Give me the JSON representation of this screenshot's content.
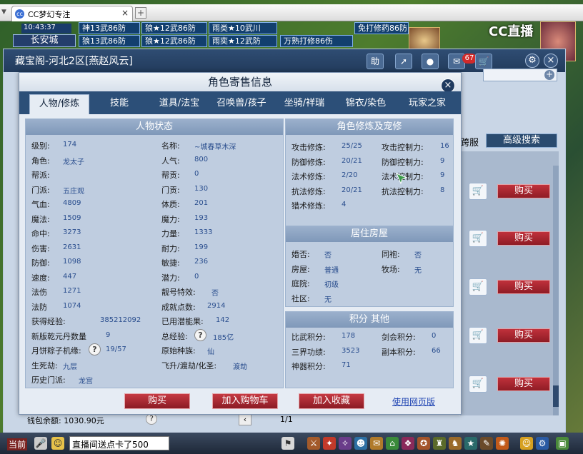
{
  "browser": {
    "tab_title": "CC梦幻专注",
    "new_tab": "+",
    "close": "×"
  },
  "hud": {
    "clock": "10:43:37",
    "location": "长安城",
    "chips": [
      "神13武86防",
      "狼★12武86防",
      "雨类★10武川",
      "狼13武86防",
      "狼★12武86防",
      "雨奕★12武防",
      "万熟打修86伤",
      "免打修药86防"
    ],
    "cc_logo": "CC直播"
  },
  "bg_window": {
    "title": "藏宝阁-河北2区[燕赵风云]",
    "help_label": "助",
    "badge": "67",
    "cross_server": "跨服",
    "advanced_search": "高级搜索",
    "buy_label": "购买",
    "money": "钱包余额: 1030.90元",
    "page": "1/1"
  },
  "modal": {
    "title": "角色寄售信息",
    "tabs": [
      "人物/修炼",
      "技能",
      "道具/法宝",
      "召唤兽/孩子",
      "坐骑/祥瑞",
      "锦衣/染色",
      "玩家之家"
    ],
    "status": {
      "header": "人物状态",
      "left": [
        {
          "label": "级别:",
          "value": "174"
        },
        {
          "label": "角色:",
          "value": "龙太子"
        },
        {
          "label": "帮派:",
          "value": ""
        },
        {
          "label": "门派:",
          "value": "五庄观"
        },
        {
          "label": "气血:",
          "value": "4809"
        },
        {
          "label": "魔法:",
          "value": "1509"
        },
        {
          "label": "命中:",
          "value": "3273"
        },
        {
          "label": "伤害:",
          "value": "2631"
        },
        {
          "label": "防御:",
          "value": "1098"
        },
        {
          "label": "速度:",
          "value": "447"
        },
        {
          "label": "法伤",
          "value": "1271"
        },
        {
          "label": "法防",
          "value": "1074"
        },
        {
          "label": "获得经验:",
          "value": "385212092"
        },
        {
          "label": "新版乾元丹数量",
          "value": "9"
        },
        {
          "label": "月饼粽子机缘:",
          "value": "19/57"
        },
        {
          "label": "生死劫:",
          "value": "九层"
        },
        {
          "label": "历史门派:",
          "value": "龙宫"
        }
      ],
      "right": [
        {
          "label": "名称:",
          "value": "~城春草木深"
        },
        {
          "label": "人气:",
          "value": "800"
        },
        {
          "label": "帮贡:",
          "value": "0"
        },
        {
          "label": "门贡:",
          "value": "130"
        },
        {
          "label": "体质:",
          "value": "201"
        },
        {
          "label": "魔力:",
          "value": "193"
        },
        {
          "label": "力量:",
          "value": "1333"
        },
        {
          "label": "耐力:",
          "value": "199"
        },
        {
          "label": "敏捷:",
          "value": "236"
        },
        {
          "label": "潜力:",
          "value": "0"
        },
        {
          "label": "靓号特效:",
          "value": "否"
        },
        {
          "label": "成就点数:",
          "value": "2914"
        },
        {
          "label": "已用潜能果:",
          "value": "142"
        },
        {
          "label": "总经验:",
          "value": "185亿"
        },
        {
          "label": "原始种族:",
          "value": "仙"
        },
        {
          "label": "飞升/渡劫/化圣:",
          "value": "渡劫"
        }
      ]
    },
    "cultivation": {
      "header": "角色修炼及宠修",
      "left": [
        {
          "label": "攻击修炼:",
          "value": "25/25"
        },
        {
          "label": "防御修炼:",
          "value": "20/21"
        },
        {
          "label": "法术修炼:",
          "value": "2/20"
        },
        {
          "label": "抗法修炼:",
          "value": "20/21"
        },
        {
          "label": "猎术修炼:",
          "value": "4"
        }
      ],
      "right": [
        {
          "label": "攻击控制力:",
          "value": "16"
        },
        {
          "label": "防御控制力:",
          "value": "9"
        },
        {
          "label": "法术控制力:",
          "value": "9"
        },
        {
          "label": "抗法控制力:",
          "value": "8"
        }
      ]
    },
    "house": {
      "header": "居住房屋",
      "left": [
        {
          "label": "婚否:",
          "value": "否"
        },
        {
          "label": "房屋:",
          "value": "普通"
        },
        {
          "label": "庭院:",
          "value": "初级"
        },
        {
          "label": "社区:",
          "value": "无"
        }
      ],
      "right": [
        {
          "label": "同袍:",
          "value": "否"
        },
        {
          "label": "牧场:",
          "value": "无"
        }
      ]
    },
    "points": {
      "header": "积分 其他",
      "left": [
        {
          "label": "比武积分:",
          "value": "178"
        },
        {
          "label": "三界功绩:",
          "value": "3523"
        },
        {
          "label": "神器积分:",
          "value": "71"
        }
      ],
      "right": [
        {
          "label": "剑会积分:",
          "value": "0"
        },
        {
          "label": "副本积分:",
          "value": "66"
        }
      ]
    },
    "buttons": {
      "buy": "购买",
      "add_cart": "加入购物车",
      "favorite": "加入收藏",
      "web": "使用网页版"
    }
  },
  "bottom": {
    "label": "当前",
    "chat": "直播间送点卡了500"
  },
  "colors": {
    "accent_red": "#b0262f",
    "header_blue": "#2c4f78",
    "value_blue": "#2a4e8e"
  }
}
